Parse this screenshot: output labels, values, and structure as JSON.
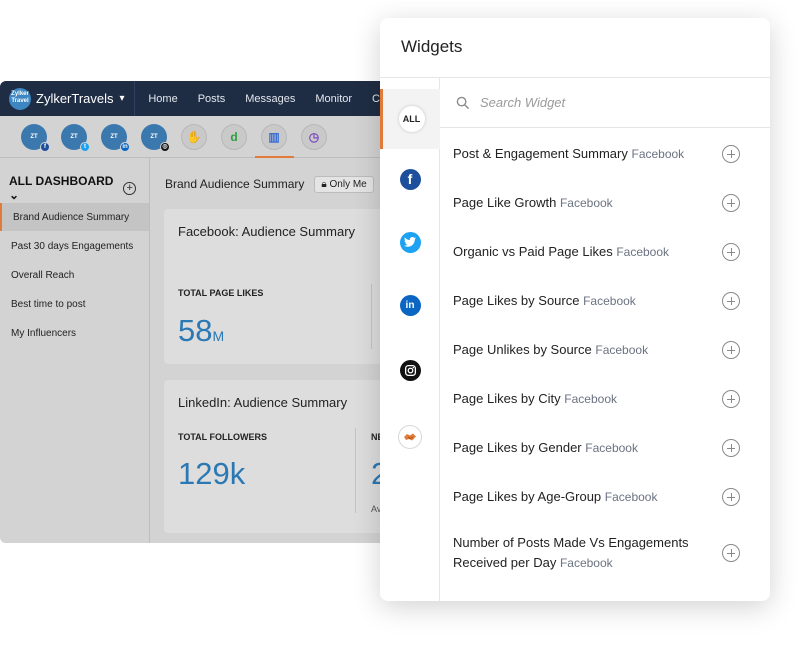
{
  "app": {
    "brand_name": "ZylkerTravels",
    "logo_text": "Zylker Travel",
    "nav": [
      "Home",
      "Posts",
      "Messages",
      "Monitor",
      "C"
    ],
    "sidebar": {
      "title": "ALL DASHBOARD",
      "items": [
        "Brand Audience Summary",
        "Past 30 days Engagements",
        "Overall Reach",
        "Best time to post",
        "My Influencers"
      ]
    },
    "main": {
      "title": "Brand Audience Summary",
      "visibility": "Only Me",
      "facebook_card": {
        "title": "Facebook: Audience Summary",
        "metric_label": "TOTAL PAGE LIKES",
        "metric_value": "58",
        "metric_unit": "M"
      },
      "linkedin_card": {
        "title": "LinkedIn: Audience Summary",
        "metric_label": "TOTAL FOLLOWERS",
        "metric_value": "129k",
        "extra_label": "NE",
        "extra_value": "2",
        "extra_small": "Av"
      }
    }
  },
  "widgets": {
    "title": "Widgets",
    "tabs": [
      {
        "label": "ALL",
        "icon": "all"
      },
      {
        "icon": "facebook-icon",
        "glyph": "f"
      },
      {
        "icon": "twitter-icon",
        "glyph": "t"
      },
      {
        "icon": "linkedin-icon",
        "glyph": "in"
      },
      {
        "icon": "instagram-icon",
        "glyph": "◎"
      },
      {
        "icon": "handshake-icon",
        "glyph": "🤝"
      }
    ],
    "search_placeholder": "Search Widget",
    "items": [
      {
        "name": "Post & Engagement Summary",
        "source": "Facebook"
      },
      {
        "name": "Page Like Growth",
        "source": "Facebook"
      },
      {
        "name": "Organic vs Paid Page Likes",
        "source": "Facebook"
      },
      {
        "name": "Page Likes by Source",
        "source": "Facebook"
      },
      {
        "name": "Page Unlikes by Source",
        "source": "Facebook"
      },
      {
        "name": "Page Likes by City",
        "source": "Facebook"
      },
      {
        "name": "Page Likes by Gender",
        "source": "Facebook"
      },
      {
        "name": "Page Likes by Age-Group",
        "source": "Facebook"
      },
      {
        "name": "Number of Posts Made Vs Engagements Received per Day",
        "source": "Facebook"
      }
    ]
  },
  "colors": {
    "accent": "#e07b39",
    "navbar": "#1f2d44",
    "metric": "#2a78b4"
  }
}
